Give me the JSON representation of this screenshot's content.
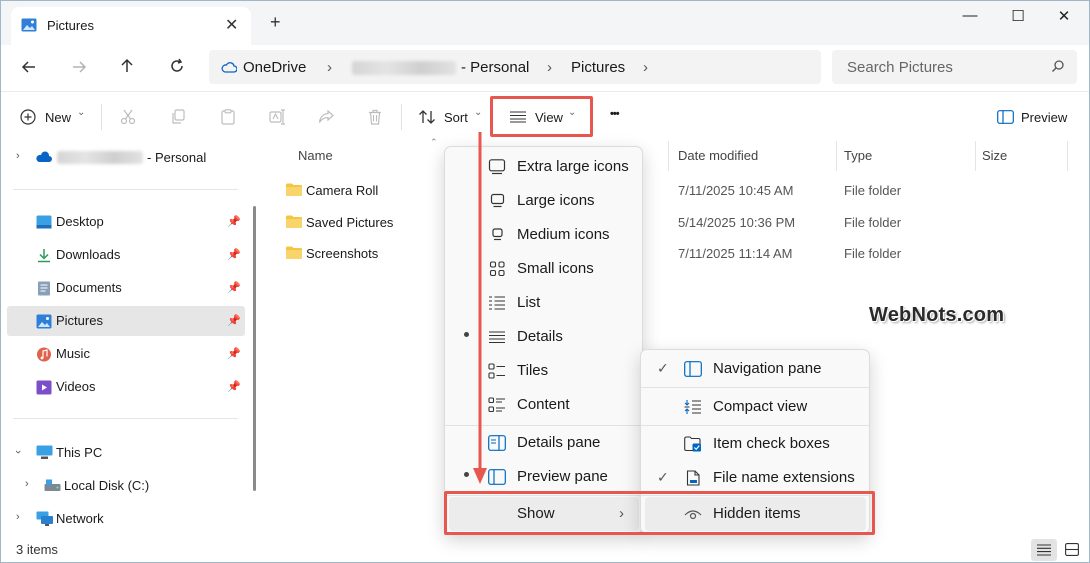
{
  "tab": {
    "title": "Pictures",
    "close": "✕",
    "add": "+"
  },
  "window_controls": {
    "minimize": "—",
    "maximize": "☐",
    "close": "✕"
  },
  "address": {
    "onedrive": "OneDrive",
    "personal": "- Personal",
    "pictures": "Pictures",
    "sep": "›"
  },
  "search": {
    "placeholder": "Search Pictures"
  },
  "toolbar": {
    "new_label": "New",
    "sort_label": "Sort",
    "view_label": "View",
    "more_label": "•••",
    "preview_label": "Preview",
    "chevron": "⌄"
  },
  "sidebar": {
    "onedrive_personal": "- Personal",
    "items": [
      {
        "label": "Desktop"
      },
      {
        "label": "Downloads"
      },
      {
        "label": "Documents"
      },
      {
        "label": "Pictures"
      },
      {
        "label": "Music"
      },
      {
        "label": "Videos"
      }
    ],
    "this_pc": "This PC",
    "local_disk": "Local Disk (C:)",
    "network": "Network"
  },
  "columns": {
    "name": "Name",
    "date": "Date modified",
    "type": "Type",
    "size": "Size"
  },
  "rows": [
    {
      "name": "Camera Roll",
      "date": "7/11/2025 10:45 AM",
      "type": "File folder"
    },
    {
      "name": "Saved Pictures",
      "date": "5/14/2025 10:36 PM",
      "type": "File folder"
    },
    {
      "name": "Screenshots",
      "date": "7/11/2025 11:14 AM",
      "type": "File folder"
    }
  ],
  "view_menu": {
    "items": [
      "Extra large icons",
      "Large icons",
      "Medium icons",
      "Small icons",
      "List",
      "Details",
      "Tiles",
      "Content",
      "Details pane",
      "Preview pane",
      "Show"
    ],
    "show_chevron": "›"
  },
  "show_menu": {
    "items": [
      "Navigation pane",
      "Compact view",
      "Item check boxes",
      "File name extensions",
      "Hidden items"
    ],
    "check": "✓"
  },
  "status": {
    "count": "3 items"
  },
  "watermark": "WebNots.com",
  "colors": {
    "highlight": "#e8574f",
    "accent": "#0067c0",
    "folder": "#f4c542"
  }
}
